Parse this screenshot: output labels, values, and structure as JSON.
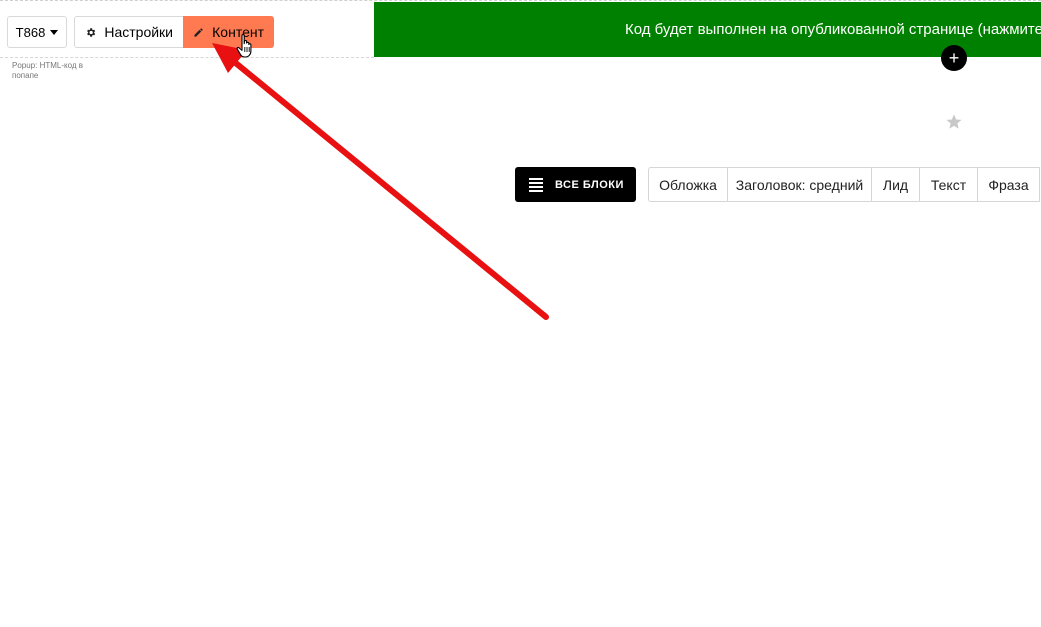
{
  "block": {
    "id_label": "T868",
    "caption": "Popup: HTML-код в попапе"
  },
  "toolbar": {
    "settings_label": "Настройки",
    "content_label": "Контент",
    "content_color": "#ff7a50"
  },
  "banner": {
    "text": "Код будет выполнен на опубликованной странице (нажмите «Оп",
    "color": "#008000"
  },
  "actions": {
    "add_symbol": "+",
    "all_blocks_label": "ВСЕ БЛОКИ"
  },
  "tabs": [
    {
      "label": "Обложка"
    },
    {
      "label": "Заголовок: средний"
    },
    {
      "label": "Лид"
    },
    {
      "label": "Текст"
    },
    {
      "label": "Фраза"
    }
  ],
  "annotation": {
    "arrow_color": "#e81010",
    "icon": "red-arrow-icon"
  }
}
